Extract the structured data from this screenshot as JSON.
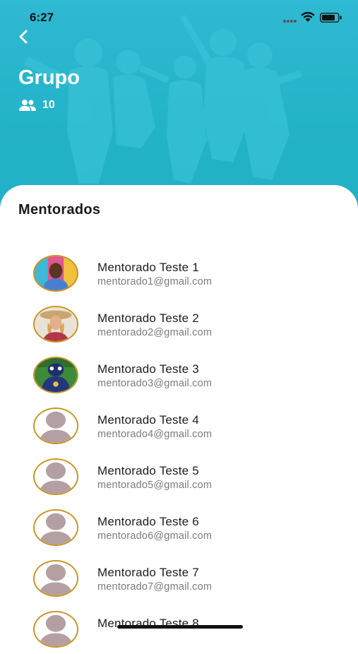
{
  "status_bar": {
    "time": "6:27"
  },
  "header": {
    "title": "Grupo",
    "member_count": "10",
    "icons": {
      "back": "chevron-left-icon",
      "members": "people-icon"
    },
    "background_color": "#23b3c9"
  },
  "section": {
    "title": "Mentorados"
  },
  "accent_color": "#c9941f",
  "mentorados": [
    {
      "name": "Mentorado Teste 1",
      "email": "mentorado1@gmail.com",
      "avatar": "photo"
    },
    {
      "name": "Mentorado Teste 2",
      "email": "mentorado2@gmail.com",
      "avatar": "photo"
    },
    {
      "name": "Mentorado Teste 3",
      "email": "mentorado3@gmail.com",
      "avatar": "photo"
    },
    {
      "name": "Mentorado Teste 4",
      "email": "mentorado4@gmail.com",
      "avatar": "placeholder"
    },
    {
      "name": "Mentorado Teste 5",
      "email": "mentorado5@gmail.com",
      "avatar": "placeholder"
    },
    {
      "name": "Mentorado Teste 6",
      "email": "mentorado6@gmail.com",
      "avatar": "placeholder"
    },
    {
      "name": "Mentorado Teste 7",
      "email": "mentorado7@gmail.com",
      "avatar": "placeholder"
    },
    {
      "name": "Mentorado Teste 8",
      "email": "",
      "avatar": "placeholder"
    }
  ]
}
